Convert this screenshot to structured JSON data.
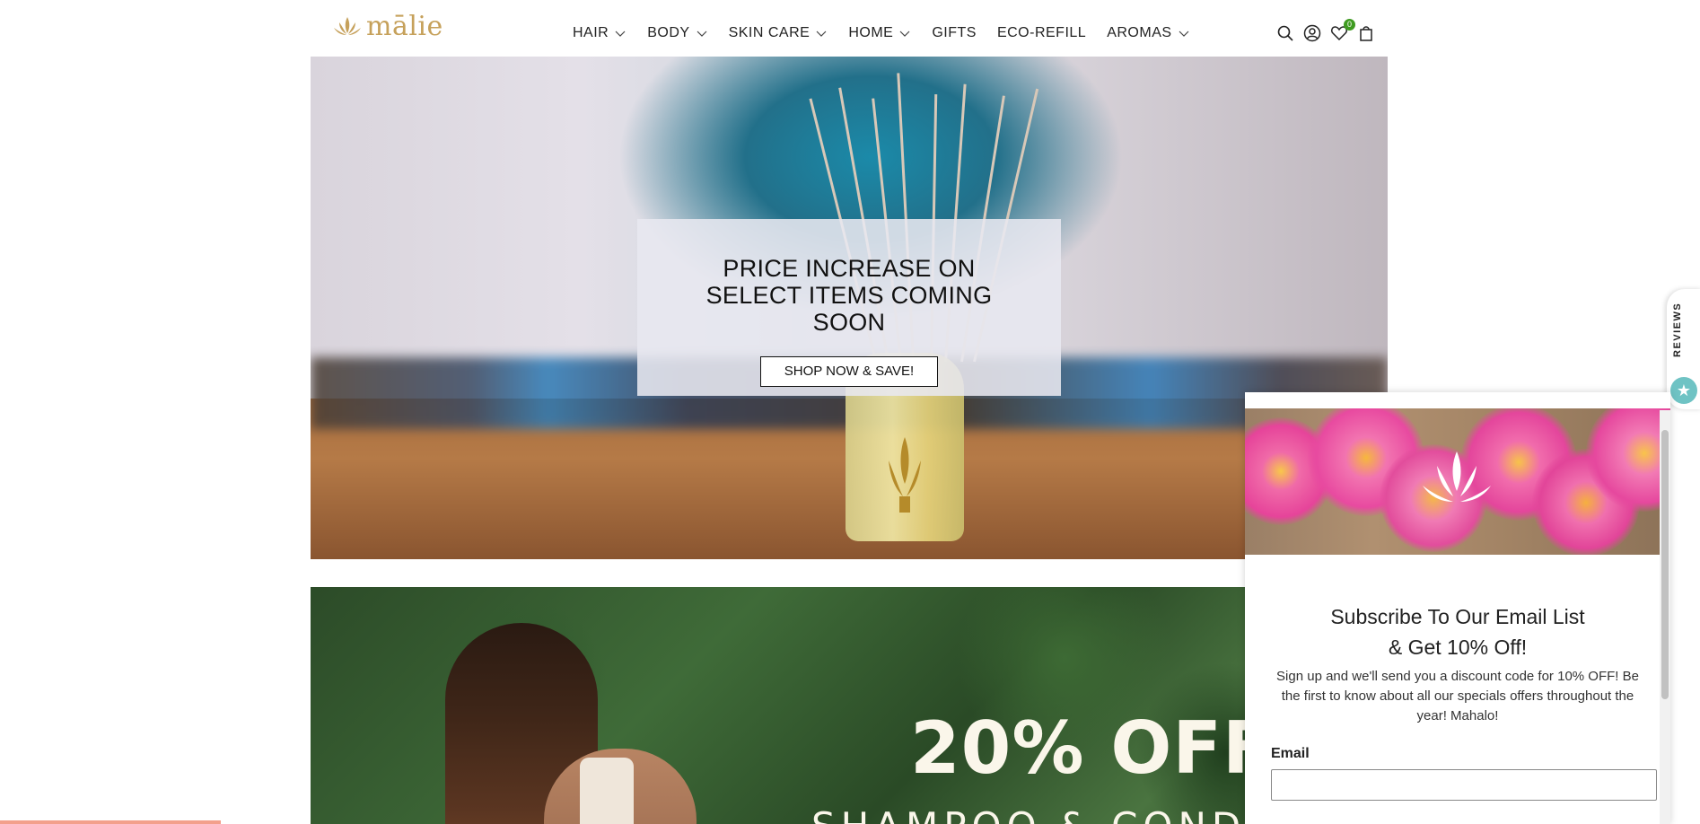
{
  "header": {
    "logo_text": "mālie",
    "nav": [
      {
        "label": "HAIR",
        "has_dropdown": true
      },
      {
        "label": "BODY",
        "has_dropdown": true
      },
      {
        "label": "SKIN CARE",
        "has_dropdown": true
      },
      {
        "label": "HOME",
        "has_dropdown": true
      },
      {
        "label": "GIFTS",
        "has_dropdown": false
      },
      {
        "label": "ECO-REFILL",
        "has_dropdown": false
      },
      {
        "label": "AROMAS",
        "has_dropdown": true
      }
    ],
    "icons": [
      "search-icon",
      "account-icon",
      "wishlist-icon",
      "cart-icon"
    ],
    "wishlist_count": "0"
  },
  "hero1": {
    "title": "PRICE INCREASE ON SELECT ITEMS COMING SOON",
    "button_label": "SHOP NOW & SAVE!"
  },
  "hero2": {
    "title": "20% OFF",
    "subtitle": "SHAMPOO & CONDITIONER"
  },
  "reviews_tab": {
    "label": "REVIEWS"
  },
  "popup": {
    "title_line1": "Subscribe To Our Email List",
    "title_line2": "& Get 10% Off!",
    "body": "Sign up and we'll send you a discount code for 10% OFF! Be the first to know about all our specials offers throughout the year! Mahalo!",
    "email_label": "Email",
    "email_value": ""
  },
  "colors": {
    "brand_gold": "#c6a15b",
    "badge_green": "#3f9b21",
    "reviews_teal": "#6fc3c4"
  }
}
